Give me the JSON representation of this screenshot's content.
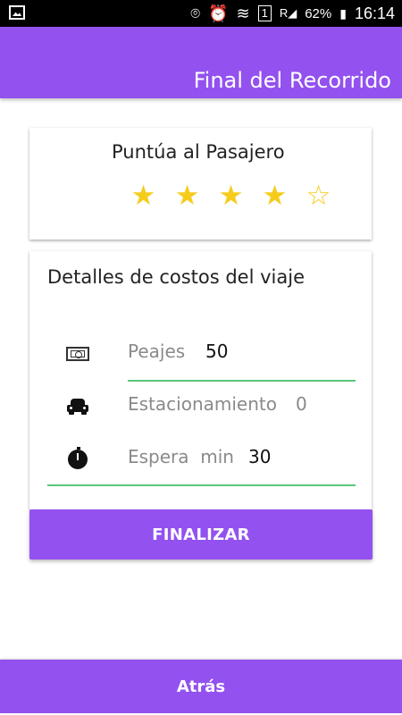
{
  "status_bar": {
    "battery": "62%",
    "time": "16:14",
    "sim_label": "1",
    "roaming_label": "R",
    "icons": [
      "image-icon",
      "location-icon",
      "alarm-icon",
      "wifi-icon",
      "sim-icon",
      "signal-icon",
      "battery-icon"
    ]
  },
  "app_bar": {
    "title": "Final del Recorrido"
  },
  "rating": {
    "title": "Puntúa al Pasajero",
    "stars_filled": 4,
    "stars_total": 5,
    "star_color": "#f6cc1c",
    "filled_glyph": "★",
    "empty_glyph": "☆"
  },
  "costs": {
    "title": "Detalles de costos del viaje",
    "rows": [
      {
        "icon": "money-icon",
        "label": "Peajes",
        "value": "50"
      },
      {
        "icon": "car-icon",
        "label": "Estacionamiento",
        "value": "0"
      },
      {
        "icon": "clock-icon",
        "label": "Espera  min",
        "value": "30"
      }
    ]
  },
  "buttons": {
    "finalize": "FINALIZAR",
    "back": "Atrás"
  },
  "colors": {
    "primary": "#9351ef",
    "underline": "#57c87b",
    "star": "#f6cc1c"
  }
}
